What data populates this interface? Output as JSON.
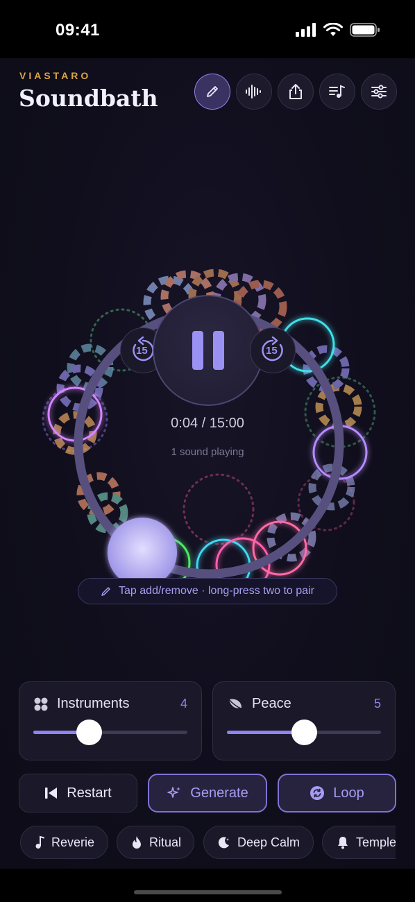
{
  "status_bar": {
    "time": "09:41"
  },
  "header": {
    "brand": "VIASTARO",
    "title": "Soundbath",
    "tools": [
      {
        "icon": "pencil-icon",
        "active": true
      },
      {
        "icon": "waveform-icon",
        "active": false
      },
      {
        "icon": "share-icon",
        "active": false
      },
      {
        "icon": "playlist-icon",
        "active": false
      },
      {
        "icon": "sliders-icon",
        "active": false
      }
    ]
  },
  "player": {
    "skip_back": "15",
    "skip_forward": "15",
    "time": "0:04 / 15:00",
    "status": "1 sound playing"
  },
  "hint": {
    "text": "Tap add/remove · long-press two to pair"
  },
  "sliders": {
    "instruments": {
      "label": "Instruments",
      "value": "4",
      "fraction": 0.36
    },
    "peace": {
      "label": "Peace",
      "value": "5",
      "fraction": 0.5
    }
  },
  "actions": {
    "restart": "Restart",
    "generate": "Generate",
    "loop": "Loop"
  },
  "presets": [
    "Reverie",
    "Ritual",
    "Deep Calm",
    "Temple"
  ],
  "colors": {
    "accent": "#8f82f2",
    "brand": "#d9a544",
    "background": "#0c0b15"
  }
}
